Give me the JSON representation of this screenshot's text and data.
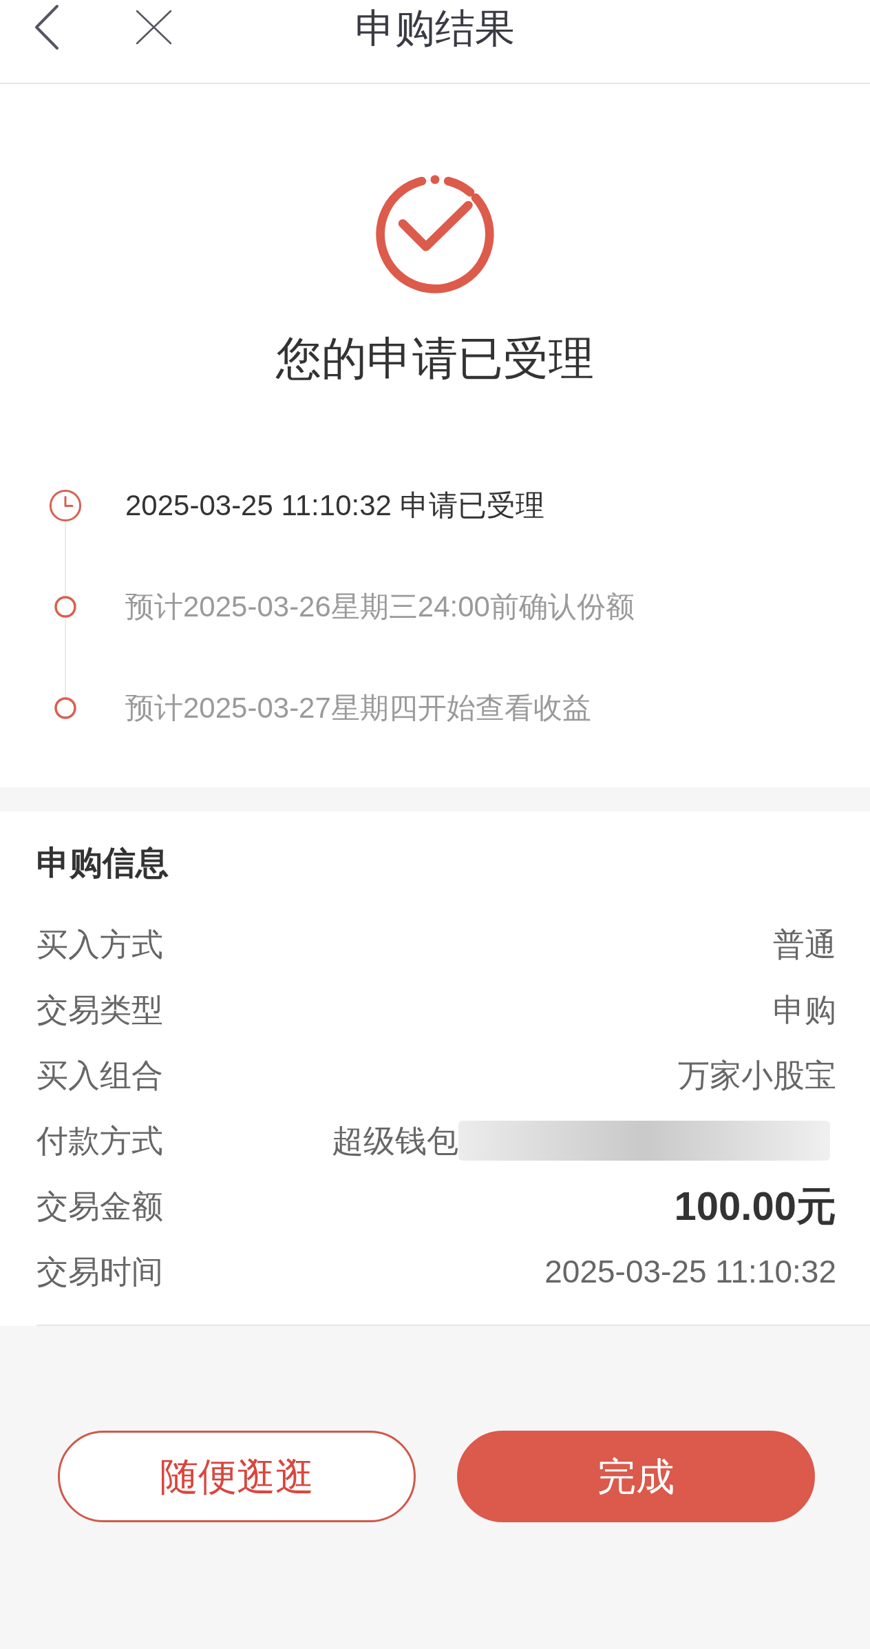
{
  "nav": {
    "title": "申购结果"
  },
  "result": {
    "kind": "success",
    "message": "您的申请已受理"
  },
  "timeline": [
    {
      "kind": "clock",
      "completed": true,
      "text": "2025-03-25 11:10:32 申请已受理"
    },
    {
      "kind": "dot",
      "completed": false,
      "text": "预计2025-03-26星期三24:00前确认份额"
    },
    {
      "kind": "dot",
      "completed": false,
      "text": "预计2025-03-27星期四开始查看收益"
    }
  ],
  "info": {
    "title": "申购信息",
    "rows": [
      {
        "kind": "plain",
        "label": "买入方式",
        "value": "普通"
      },
      {
        "kind": "plain",
        "label": "交易类型",
        "value": "申购"
      },
      {
        "kind": "plain",
        "label": "买入组合",
        "value": "万家小股宝"
      },
      {
        "kind": "masked",
        "label": "付款方式",
        "value": "超级钱包"
      },
      {
        "kind": "amount",
        "label": "交易金额",
        "value": "100.00元"
      },
      {
        "kind": "plain",
        "label": "交易时间",
        "value": "2025-03-25 11:10:32"
      }
    ]
  },
  "buttons": [
    {
      "kind": "outline",
      "label": "随便逛逛"
    },
    {
      "kind": "primary",
      "label": "完成"
    }
  ]
}
